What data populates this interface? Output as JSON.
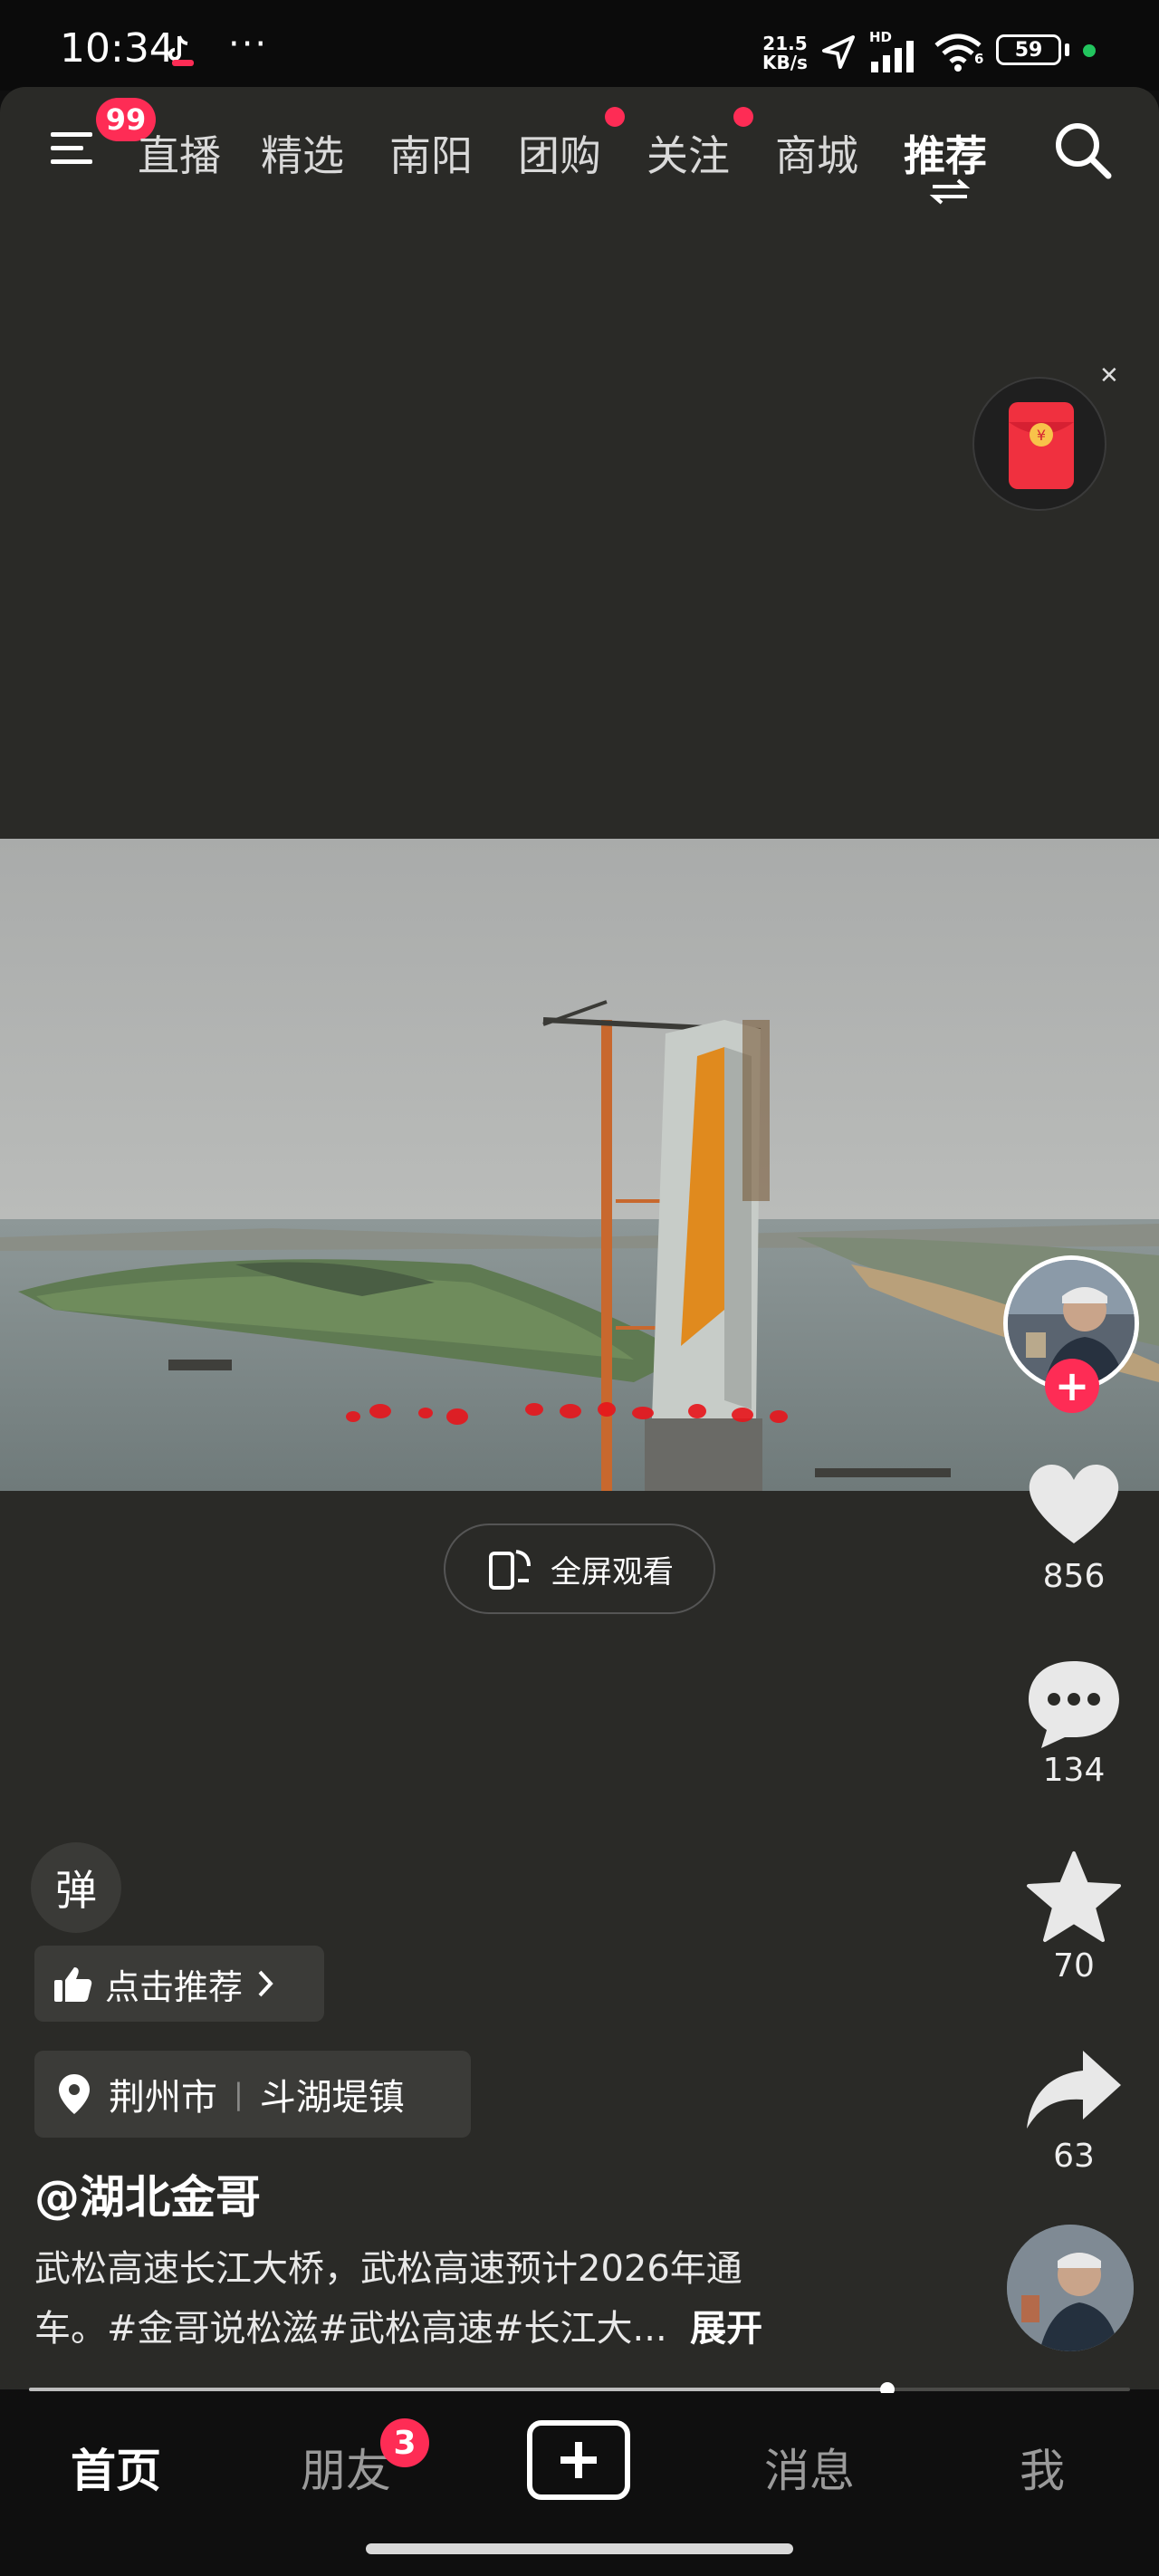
{
  "status_bar": {
    "time": "10:34",
    "more": "···",
    "net_speed_value": "21.5",
    "net_speed_unit": "KB/s",
    "hd_label": "HD",
    "wifi_label": "6",
    "battery": "59"
  },
  "top_nav": {
    "menu_badge": "99",
    "tabs": [
      {
        "label": "直播",
        "shown": "直播"
      },
      {
        "label": "精选"
      },
      {
        "label": "南阳"
      },
      {
        "label": "团购"
      },
      {
        "label": "关注"
      },
      {
        "label": "商城"
      },
      {
        "label": "推荐"
      }
    ]
  },
  "video": {
    "fullscreen_label": "全屏观看"
  },
  "actions": {
    "likes": "856",
    "comments": "134",
    "favorites": "70",
    "shares": "63"
  },
  "post": {
    "danmu_label": "弹",
    "recommend_label": "点击推荐",
    "location_city": "荆州市",
    "location_town": "斗湖堤镇",
    "author": "@湖北金哥",
    "caption_line1": "武松高速长江大桥，武松高速预计2026年通",
    "caption_line2": "车。#金哥说松滋#武松高速#长江大...",
    "expand_label": "展开",
    "progress": 0.78
  },
  "bottom_nav": {
    "home": "首页",
    "friends": "朋友",
    "friends_badge": "3",
    "messages": "消息",
    "me": "我"
  },
  "colors": {
    "accent": "#fe2c55",
    "background": "#2a2a27",
    "bar": "#0f0f0f"
  },
  "icons": [
    "menu-icon",
    "switch-feed-icon",
    "search-icon",
    "red-packet-icon",
    "close-icon",
    "phone-rotate-icon",
    "heart-icon",
    "comment-icon",
    "star-icon",
    "share-icon",
    "thumbs-up-icon",
    "location-pin-icon",
    "chevron-right-icon",
    "plus-icon"
  ]
}
